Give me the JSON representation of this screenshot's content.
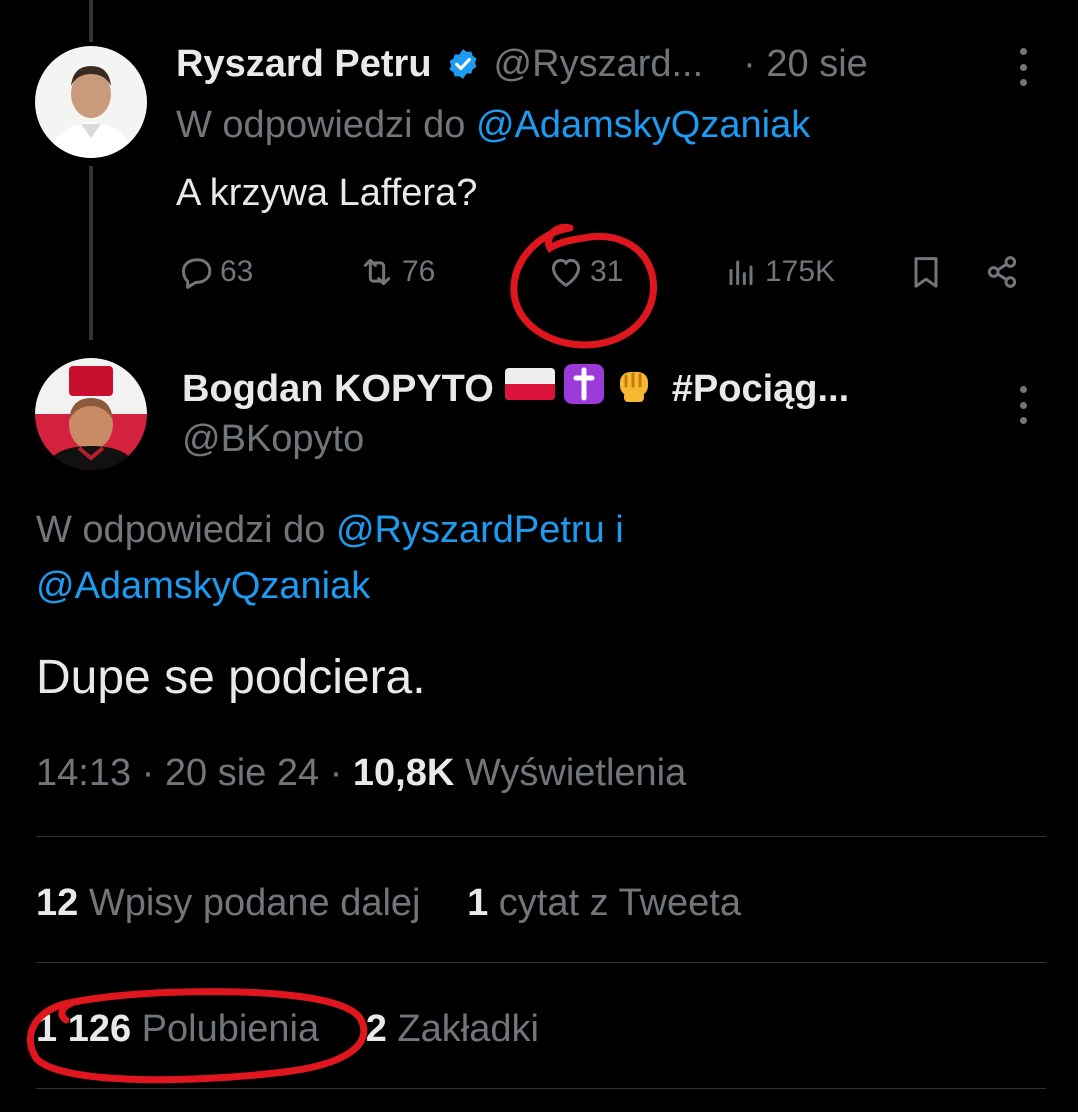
{
  "tweet1": {
    "name": "Ryszard Petru",
    "handle": "@Ryszard...",
    "time": "· 20 sie",
    "reply_prefix": "W odpowiedzi do",
    "reply_mention": "@AdamskyQzaniak",
    "text": "A krzywa Laffera?",
    "actions": {
      "replies": "63",
      "retweets": "76",
      "likes": "31",
      "views": "175K"
    }
  },
  "tweet2": {
    "name": "Bogdan KOPYTO",
    "name_suffix": "#Pociąg...",
    "handle": "@BKopyto",
    "reply_prefix": "W odpowiedzi do",
    "reply_mention1": "@RyszardPetru",
    "reply_joiner": "i",
    "reply_mention2": "@AdamskyQzaniak",
    "text": "Dupe se podciera.",
    "meta_time": "14:13 · 20 sie 24 ·",
    "meta_views_count": "10,8K",
    "meta_views_label": "Wyświetlenia",
    "retweets_count": "12",
    "retweets_label": "Wpisy podane dalej",
    "quotes_count": "1",
    "quotes_label": "cytat z Tweeta",
    "likes_count": "1 126",
    "likes_label": "Polubienia",
    "bookmarks_count": "2",
    "bookmarks_label": "Zakładki"
  },
  "colors": {
    "background": "#000000",
    "text": "#e7e9ea",
    "muted": "#71767b",
    "link": "#1d9bf0",
    "divider": "#2f3336",
    "annotation": "#e0161e"
  },
  "icons": [
    "reply-icon",
    "retweet-icon",
    "like-icon",
    "views-icon",
    "bookmark-icon",
    "share-icon",
    "verified-badge-icon",
    "more-icon",
    "poland-flag-emoji",
    "latin-cross-emoji",
    "fist-emoji"
  ]
}
